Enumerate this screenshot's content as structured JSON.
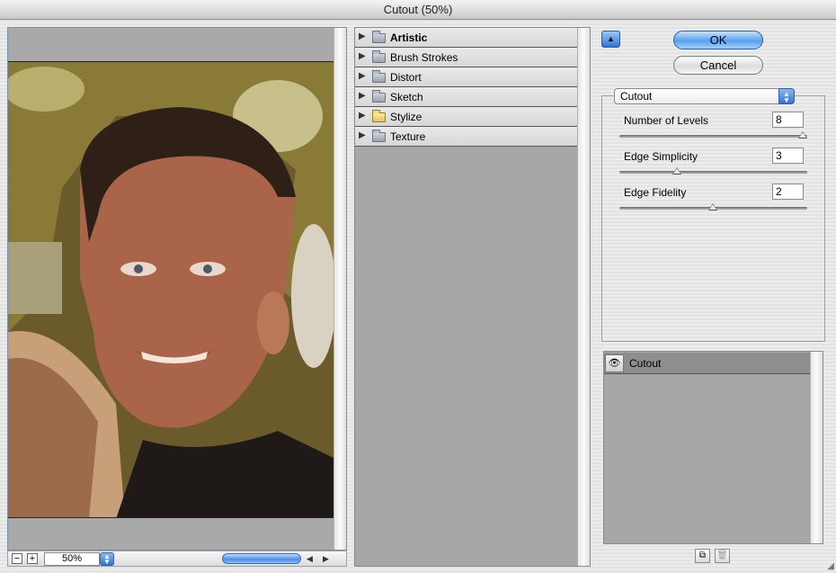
{
  "window": {
    "title": "Cutout (50%)"
  },
  "preview": {
    "zoom_value": "50%",
    "zoom_out_glyph": "−",
    "zoom_in_glyph": "+",
    "scroll_left_glyph": "◀",
    "scroll_right_glyph": "▶"
  },
  "filter_categories": [
    {
      "label": "Artistic",
      "expanded": false,
      "bold": true,
      "folder_color": "gray"
    },
    {
      "label": "Brush Strokes",
      "expanded": false,
      "bold": false,
      "folder_color": "gray"
    },
    {
      "label": "Distort",
      "expanded": false,
      "bold": false,
      "folder_color": "gray"
    },
    {
      "label": "Sketch",
      "expanded": false,
      "bold": false,
      "folder_color": "gray"
    },
    {
      "label": "Stylize",
      "expanded": false,
      "bold": false,
      "folder_color": "yellow"
    },
    {
      "label": "Texture",
      "expanded": false,
      "bold": false,
      "folder_color": "gray"
    }
  ],
  "buttons": {
    "ok": "OK",
    "cancel": "Cancel",
    "collapse_glyph": "▲"
  },
  "filter_select": {
    "value": "Cutout"
  },
  "params": [
    {
      "label": "Number of Levels",
      "value": "8",
      "slider_fraction": 1.0
    },
    {
      "label": "Edge Simplicity",
      "value": "3",
      "slider_fraction": 0.3
    },
    {
      "label": "Edge Fidelity",
      "value": "2",
      "slider_fraction": 0.5
    }
  ],
  "layers": [
    {
      "label": "Cutout",
      "visible": true
    }
  ],
  "layer_buttons": {
    "new_glyph": "⧉",
    "delete_glyph": "🗑"
  },
  "icons": {
    "eye": "eye-icon",
    "folder": "folder-icon",
    "disclosure": "disclosure-triangle-icon",
    "stepper": "stepper-arrows-icon"
  }
}
